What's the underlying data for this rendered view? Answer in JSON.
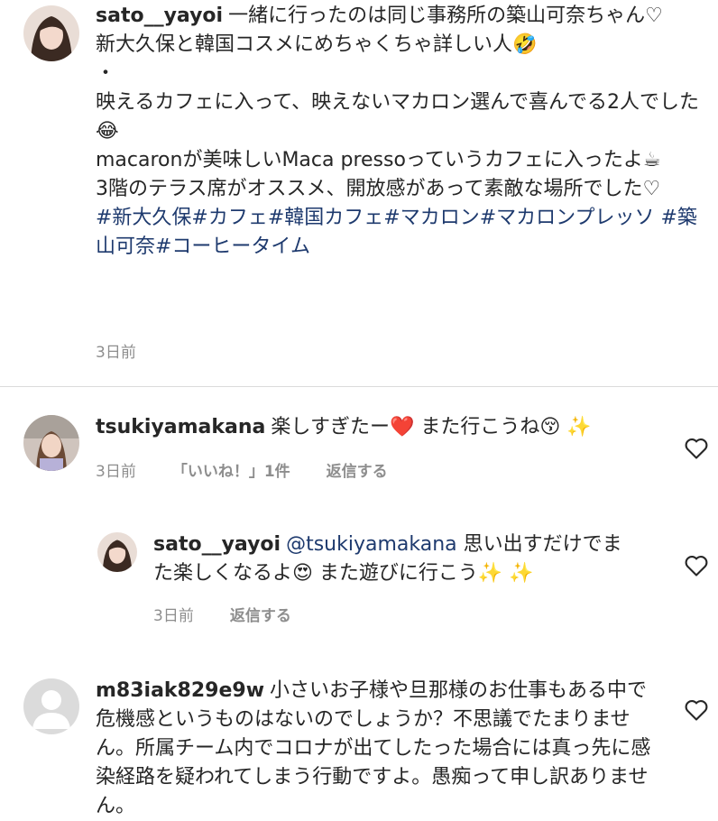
{
  "post": {
    "username": "sato__yayoi",
    "line1": "一緒に行ったのは同じ事務所の築山可奈ちゃん♡",
    "line2": "新大久保と韓国コスメにめちゃくちゃ詳しい人🤣",
    "line3": "・",
    "line4": "映えるカフェに入って、映えないマカロン選んで喜んでる2人でした😂",
    "line5": "macaronが美味しいMaca pressoっていうカフェに入ったよ☕",
    "line6": "3階のテラス席がオススメ、開放感があって素敵な場所でした♡",
    "hashtags": "#新大久保#カフェ#韓国カフェ#マカロン#マカロンプレッソ #築山可奈#コーヒータイム",
    "time": "3日前"
  },
  "comments": [
    {
      "username": "tsukiyamakana",
      "text": "楽しすぎたー❤️ また行こうね😚 ✨",
      "time": "3日前",
      "likes": "「いいね！」1件",
      "reply": "返信する"
    },
    {
      "username": "sato__yayoi",
      "mention": "@tsukiyamakana",
      "text": " 思い出すだけでまた楽しくなるよ😍 また遊びに行こう✨ ✨",
      "time": "3日前",
      "reply": "返信する"
    },
    {
      "username": "m83iak829e9w",
      "text": "小さいお子様や旦那様のお仕事もある中で危機感というものはないのでしょうか？不思議でたまりません。所属チーム内でコロナが出てしたった場合には真っ先に感染経路を疑われてしまう行動ですよ。愚痴って申し訳ありません。"
    }
  ],
  "icons": {
    "heart": "heart-outline-icon",
    "avatar_default": "default-avatar-icon"
  }
}
